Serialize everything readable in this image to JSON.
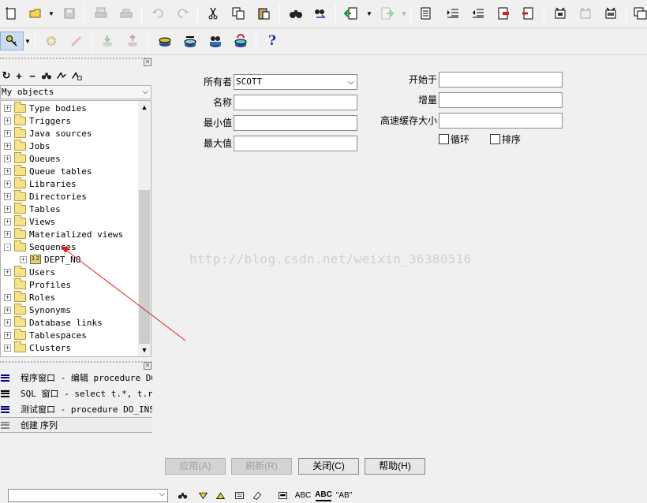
{
  "left_panel": {
    "filter": "My objects",
    "tree": [
      {
        "label": "Type bodies",
        "exp": "+"
      },
      {
        "label": "Triggers",
        "exp": "+"
      },
      {
        "label": "Java sources",
        "exp": "+"
      },
      {
        "label": "Jobs",
        "exp": "+"
      },
      {
        "label": "Queues",
        "exp": "+"
      },
      {
        "label": "Queue tables",
        "exp": "+"
      },
      {
        "label": "Libraries",
        "exp": "+"
      },
      {
        "label": "Directories",
        "exp": "+"
      },
      {
        "label": "Tables",
        "exp": "+"
      },
      {
        "label": "Views",
        "exp": "+"
      },
      {
        "label": "Materialized views",
        "exp": "+"
      },
      {
        "label": "Sequences",
        "exp": "-"
      },
      {
        "label": "DEPT_NO",
        "exp": "+",
        "child": true
      },
      {
        "label": "Users",
        "exp": "+"
      },
      {
        "label": "Profiles",
        "exp": ""
      },
      {
        "label": "Roles",
        "exp": "+"
      },
      {
        "label": "Synonyms",
        "exp": "+"
      },
      {
        "label": "Database links",
        "exp": "+"
      },
      {
        "label": "Tablespaces",
        "exp": "+"
      },
      {
        "label": "Clusters",
        "exp": "+"
      }
    ],
    "windows": [
      {
        "text": "程序窗口 - 编辑 procedure DO"
      },
      {
        "text": "SQL 窗口 - select t.*, t.row"
      },
      {
        "text": "测试窗口 - procedure DO_INSE"
      },
      {
        "text": "创建 序列"
      }
    ]
  },
  "form": {
    "owner_label": "所有者",
    "owner_value": "SCOTT",
    "name_label": "名称",
    "min_label": "最小值",
    "max_label": "最大值",
    "start_label": "开始于",
    "increment_label": "增量",
    "cache_label": "高速缓存大小",
    "cycle_label": "循环",
    "order_label": "排序"
  },
  "buttons": {
    "apply": "应用(A)",
    "refresh": "刷新(R)",
    "close": "关闭(C)",
    "help": "帮助(H)"
  },
  "watermark": "http://blog.csdn.net/weixin_36380516",
  "bottom_bar": {
    "abc1": "ABC",
    "abc2": "ABC",
    "ab_quote": "\"AB\""
  },
  "colors": {
    "accent_blue": "#000080",
    "folder": "#f6e28a",
    "arrow": "#e02020"
  }
}
